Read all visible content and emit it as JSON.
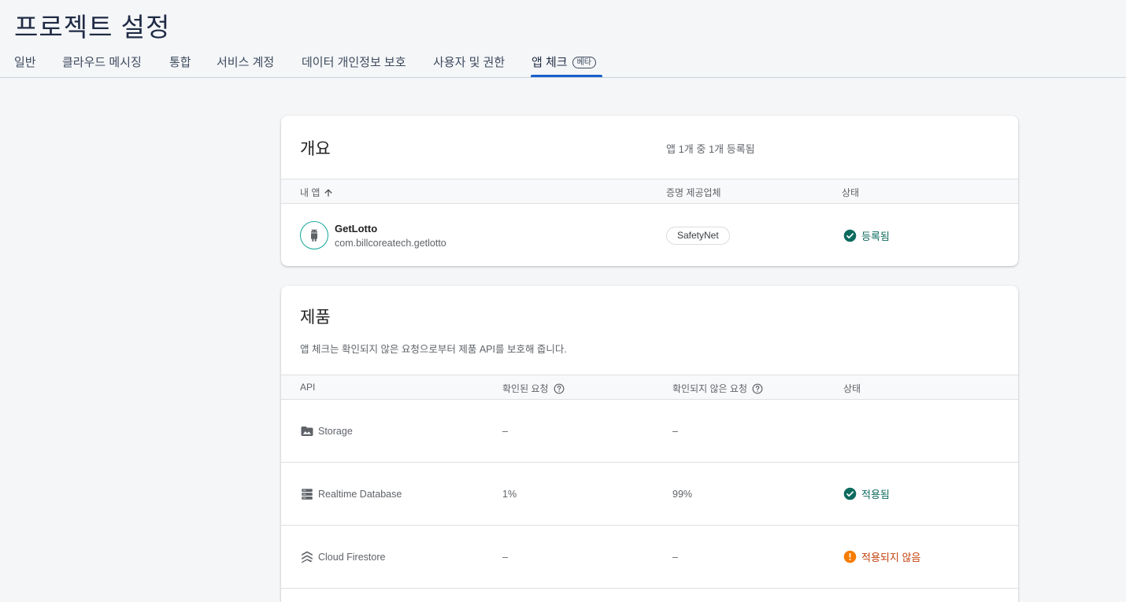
{
  "header": {
    "title": "프로젝트 설정"
  },
  "tabs": [
    {
      "label": "일반"
    },
    {
      "label": "클라우드 메시징"
    },
    {
      "label": "통합"
    },
    {
      "label": "서비스 계정"
    },
    {
      "label": "데이터 개인정보 보호"
    },
    {
      "label": "사용자 및 권한"
    },
    {
      "label": "앱 체크",
      "badge": "베타",
      "active": true
    }
  ],
  "overview": {
    "title": "개요",
    "summary": "앱 1개 중 1개 등록됨",
    "columns": {
      "app": "내 앱",
      "provider": "증명 제공업체",
      "status": "상태"
    },
    "apps": [
      {
        "name": "GetLotto",
        "package": "com.billcoreatech.getlotto",
        "provider": "SafetyNet",
        "status": "등록됨",
        "icon": "android-icon"
      }
    ]
  },
  "products": {
    "title": "제품",
    "description": "앱 체크는 확인되지 않은 요청으로부터 제품 API를 보호해 줍니다.",
    "columns": {
      "api": "API",
      "verified": "확인된 요청",
      "unverified": "확인되지 않은 요청",
      "status": "상태"
    },
    "rows": [
      {
        "name": "Storage",
        "icon": "storage-image-icon",
        "verified": "–",
        "unverified": "–",
        "status": ""
      },
      {
        "name": "Realtime Database",
        "icon": "database-icon",
        "verified": "1%",
        "unverified": "99%",
        "status": "적용됨",
        "status_type": "ok"
      },
      {
        "name": "Cloud Firestore",
        "icon": "firestore-icon",
        "verified": "–",
        "unverified": "–",
        "status": "적용되지 않음",
        "status_type": "warn"
      }
    ]
  },
  "colors": {
    "accent": "#1a5fcc",
    "success": "#0d6b5e",
    "warning": "#f57c00",
    "android_teal": "#12a89a"
  }
}
